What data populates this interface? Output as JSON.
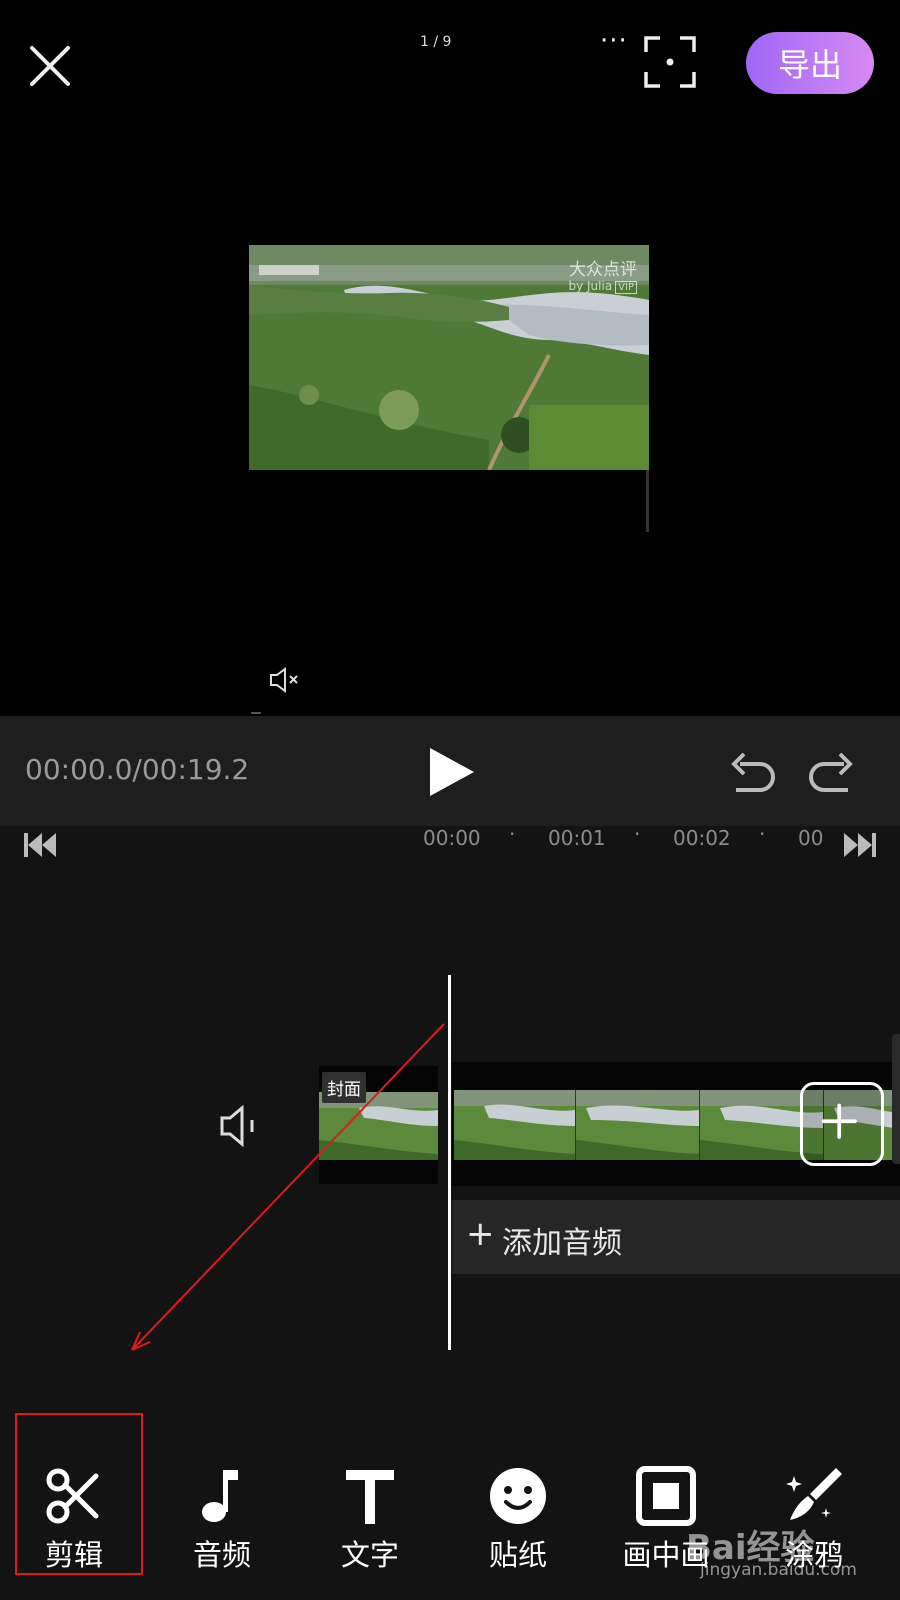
{
  "top_bar": {
    "page_indicator": "1 / 9",
    "more_icon": "···",
    "export_label": "导出",
    "export_gradient": [
      "#a066f7",
      "#d68bf4"
    ]
  },
  "preview": {
    "watermark_line1": "大众点评",
    "watermark_line2": "by Julia",
    "watermark_vip": "VIP"
  },
  "control_bar": {
    "time_readout": "00:00.0/00:19.2"
  },
  "timeline": {
    "ruler": [
      "00:00",
      "00:01",
      "00:02",
      "00"
    ],
    "cover_label": "封面",
    "add_audio_label": "添加音频"
  },
  "toolbar": {
    "items": [
      {
        "label": "剪辑",
        "icon": "scissors-icon"
      },
      {
        "label": "音频",
        "icon": "music-note-icon"
      },
      {
        "label": "文字",
        "icon": "text-icon"
      },
      {
        "label": "贴纸",
        "icon": "smiley-icon"
      },
      {
        "label": "画中画",
        "icon": "picture-in-picture-icon"
      },
      {
        "label": "涂鸦",
        "icon": "magic-brush-icon"
      }
    ]
  },
  "watermark": {
    "brand": "Bai经验",
    "url": "jingyan.baidu.com"
  },
  "colors": {
    "highlight": "#e0191e",
    "control_bar_bg": "#1e1e1e",
    "timeline_bg": "#131313"
  }
}
